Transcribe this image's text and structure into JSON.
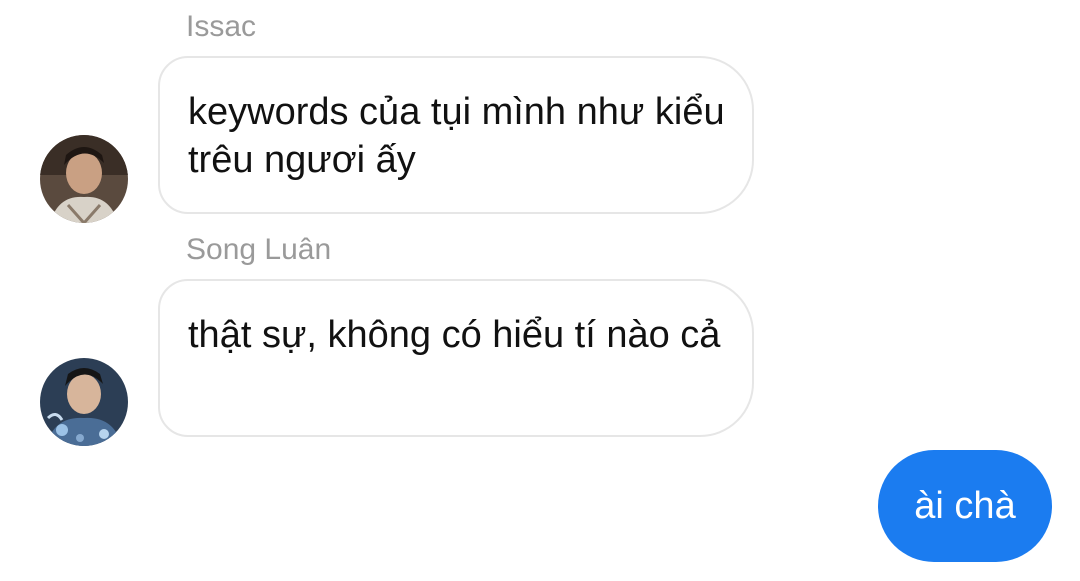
{
  "messages": [
    {
      "sender": "Issac",
      "text": "keywords của tụi mình như kiểu trêu ngươi ấy",
      "avatar_icon": "user-avatar-photo"
    },
    {
      "sender": "Song Luân",
      "text": "thật sự, không có hiểu tí nào cả",
      "avatar_icon": "user-avatar-photo"
    }
  ],
  "outgoing": {
    "text": "ài chà"
  },
  "colors": {
    "outgoing_bubble": "#1b7cf0",
    "incoming_border": "#e6e6e6",
    "sender_name": "#9a9a9a"
  }
}
